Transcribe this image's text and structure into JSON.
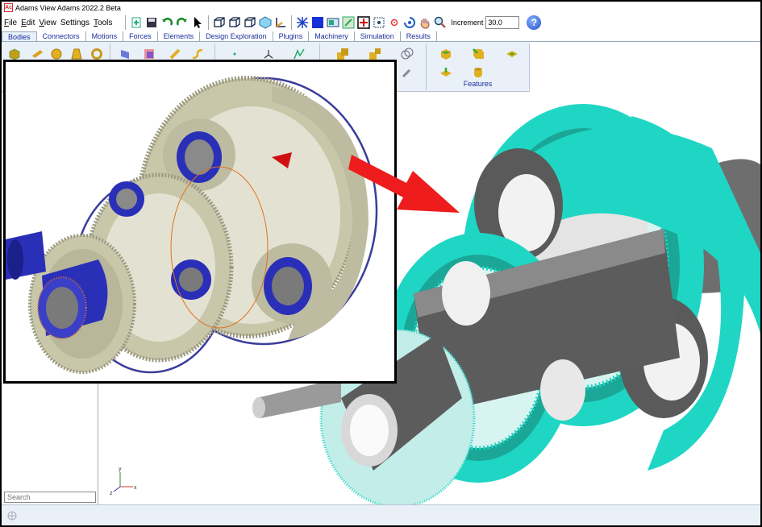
{
  "window": {
    "title": "Adams  View Adams 2022.2 Beta",
    "icon": "Adams"
  },
  "menu": {
    "items": [
      {
        "label": "File",
        "u": "F"
      },
      {
        "label": "Edit",
        "u": "E"
      },
      {
        "label": "View",
        "u": "V"
      },
      {
        "label": "Settings",
        "u": ""
      },
      {
        "label": "Tools",
        "u": "T"
      }
    ]
  },
  "toolbar": {
    "icons": [
      "new-model-icon",
      "save-icon",
      "undo-icon",
      "redo-icon",
      "select-pointer-icon",
      "view-front-icon",
      "view-top-icon",
      "view-right-icon",
      "view-iso-icon",
      "triad-icon",
      "mesh-icon",
      "render-icon",
      "toggle-icon",
      "fit-icon",
      "zoom-box-icon",
      "center-icon",
      "rotate-icon",
      "pan-icon",
      "zoom-icon"
    ],
    "increment_label": "Increment",
    "increment_value": "30.0",
    "help_icon": "help-icon"
  },
  "tabs": [
    {
      "label": "Bodies",
      "active": true
    },
    {
      "label": "Connectors"
    },
    {
      "label": "Motions"
    },
    {
      "label": "Forces"
    },
    {
      "label": "Elements"
    },
    {
      "label": "Design Exploration"
    },
    {
      "label": "Plugins"
    },
    {
      "label": "Machinery"
    },
    {
      "label": "Simulation"
    },
    {
      "label": "Results"
    }
  ],
  "ribbon": {
    "features_label": "Features"
  },
  "left_panel": {
    "search_placeholder": "Search"
  },
  "triad": {
    "x": "x",
    "y": "y",
    "z": "z"
  },
  "colors": {
    "gear_teal": "#1fd6c4",
    "gear_tan": "#c8c7aa",
    "bearing_blue": "#2a2fb8",
    "arrow_red": "#ee1c1c",
    "tab_text": "#1a2f9c",
    "ribbon_bg": "#eaf0f8"
  }
}
